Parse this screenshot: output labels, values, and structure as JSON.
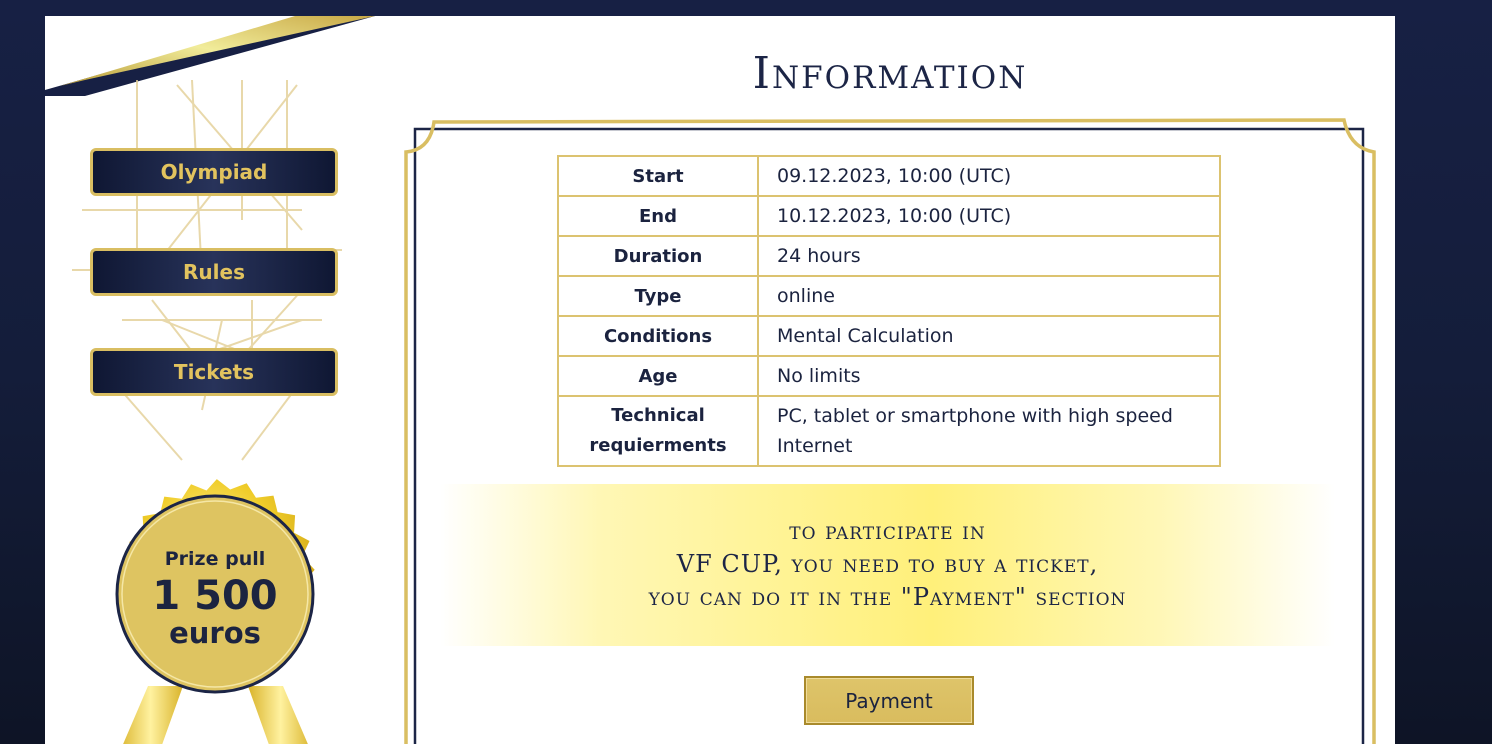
{
  "sidebar": {
    "items": [
      {
        "label": "Olympiad"
      },
      {
        "label": "Rules"
      },
      {
        "label": "Tickets"
      }
    ],
    "prize": {
      "label": "Prize pull",
      "amount": "1 500",
      "unit": "euros"
    }
  },
  "main": {
    "title": "Information",
    "info_rows": [
      {
        "key": "Start",
        "value": "09.12.2023, 10:00 (UTC)"
      },
      {
        "key": "End",
        "value": "10.12.2023, 10:00 (UTC)"
      },
      {
        "key": "Duration",
        "value": "24 hours"
      },
      {
        "key": "Type",
        "value": "online"
      },
      {
        "key": "Conditions",
        "value": "Mental Calculation"
      },
      {
        "key": "Age",
        "value": "No limits"
      },
      {
        "key": "Technical requierments",
        "value": "PC, tablet or smartphone with high speed Internet"
      }
    ],
    "notice": {
      "line1": "to participate in",
      "line2": "VF CUP, you need to buy a ticket,",
      "line3": "you can do it in the \"Payment\" section"
    },
    "payment_label": "Payment"
  },
  "colors": {
    "navy": "#172044",
    "gold": "#d9be62",
    "text_dark": "#1c2546"
  },
  "icons": [
    "gold-ribbon-decoration",
    "geometric-lines-decoration",
    "prize-medal-icon",
    "notice-frame-decoration"
  ]
}
